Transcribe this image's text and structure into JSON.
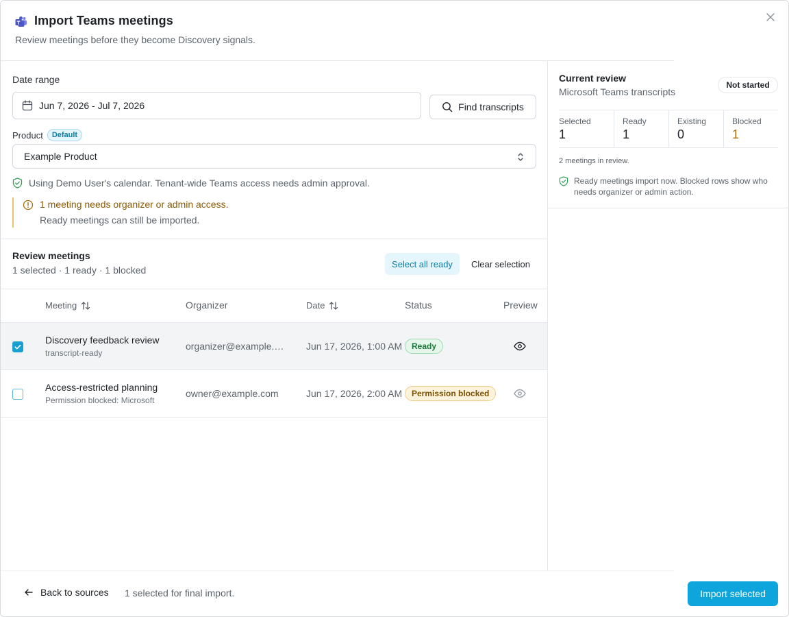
{
  "header": {
    "title": "Import Teams meetings",
    "subtitle": "Review meetings before they become Discovery signals.",
    "icon": "teams-icon",
    "close_icon": "close-icon"
  },
  "form": {
    "date_label": "Date range",
    "date_value": "Jun 7, 2026 - Jul 7, 2026",
    "find_button": "Find transcripts",
    "product_label": "Product",
    "product_badge": "Default",
    "product_value": "Example Product",
    "calendar_note": "Using Demo User's calendar. Tenant-wide Teams access needs admin approval.",
    "warning_title": "1 meeting needs organizer or admin access.",
    "warning_sub": "Ready meetings can still be imported."
  },
  "review": {
    "title": "Review meetings",
    "summary": "1 selected · 1 ready · 1 blocked",
    "select_all": "Select all ready",
    "clear": "Clear selection",
    "columns": {
      "meeting": "Meeting",
      "organizer": "Organizer",
      "date": "Date",
      "status": "Status",
      "preview": "Preview"
    },
    "rows": [
      {
        "checked": true,
        "title": "Discovery feedback review",
        "sub": "transcript-ready",
        "organizer": "organizer@example.com",
        "date": "Jun 17, 2026, 1:00 AM",
        "status": "Ready"
      },
      {
        "checked": false,
        "title": "Access-restricted planning",
        "sub": "Permission blocked: Microsoft",
        "organizer": "owner@example.com",
        "date": "Jun 17, 2026, 2:00 AM",
        "status": "Permission blocked"
      }
    ]
  },
  "panel": {
    "title": "Current review",
    "subtitle": "Microsoft Teams transcripts",
    "state": "Not started",
    "stats": [
      {
        "label": "Selected",
        "value": "1"
      },
      {
        "label": "Ready",
        "value": "1"
      },
      {
        "label": "Existing",
        "value": "0"
      },
      {
        "label": "Blocked",
        "value": "1"
      }
    ],
    "count": "2 meetings in review.",
    "note": "Ready meetings import now. Blocked rows show who needs organizer or admin action."
  },
  "footer": {
    "back": "Back to sources",
    "note": "1 selected for final import.",
    "import": "Import selected"
  },
  "colors": {
    "accent": "#0ea5dc",
    "ready": "#1e7a3c",
    "blocked": "#7a5200",
    "warning": "#8a5a00"
  }
}
